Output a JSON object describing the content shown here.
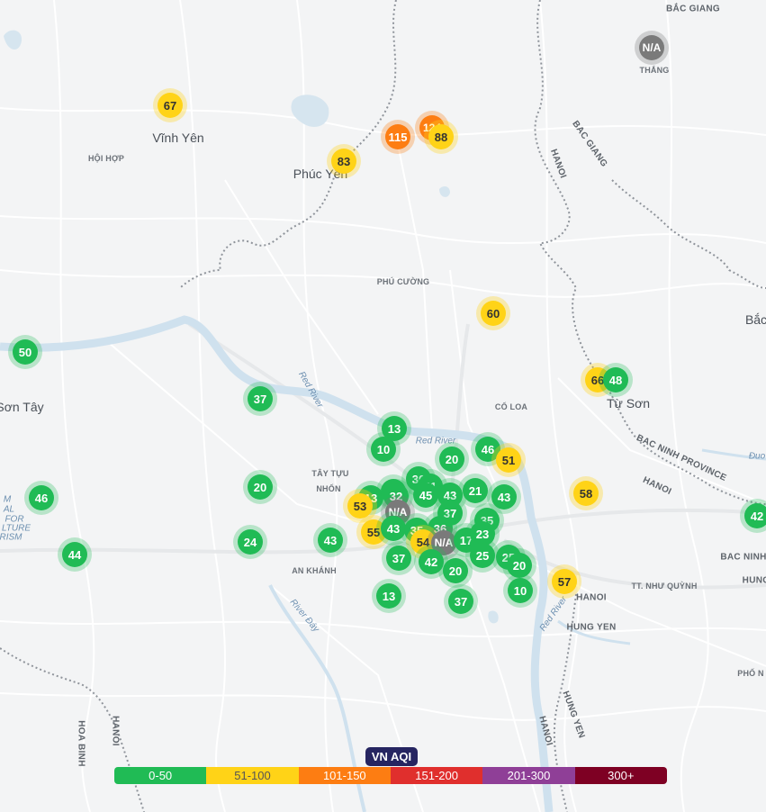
{
  "place_labels": {
    "vinh_yen": "Vĩnh Yên",
    "hoi_hop": "HỘI HỢP",
    "phuc_yen": "Phúc Yên",
    "phu_cuong": "PHÚ CƯỜNG",
    "son_tay": "Sơn Tây",
    "co_loa": "CỔ LOA",
    "tu_son": "Từ Sơn",
    "tay_tuu": "TÂY TỰU",
    "nhon": "NHỔN",
    "an_khanh": "AN KHÁNH",
    "thang": "THẮNG",
    "bac_giang_top": "BẮC GIANG",
    "bac_giang": "BAC GIANG",
    "hanoi_1": "HANOI",
    "bac_ninh_province": "BAC NINH PROVINCE",
    "hanoi_2": "HANOI",
    "hanoi_3": "HANOI",
    "hung_yen": "HUNG YEN",
    "te_nhu_quynh": "TT. NHƯ QUỲNH",
    "bac_ninh": "BAC NINH",
    "hung": "HUNG",
    "pho_n": "PHỐ N",
    "hoa_binh": "HOA BINH",
    "hanoi_4": "HANOI",
    "hanoi_5": "HANOI",
    "hung_yen_2": "HUNG YEN",
    "bac_edge": "Bắc",
    "red_river_1": "Red River",
    "red_river_2": "Red River",
    "red_river_3": "Red River",
    "river_day": "River Đáy",
    "duo_edge": "Đuo",
    "museum_1": "M",
    "museum_2": "AL",
    "museum_3": "FOR",
    "museum_4": "LTURE",
    "museum_5": "RISM"
  },
  "markers": [
    {
      "id": "m1",
      "value": "N/A",
      "level": "na"
    },
    {
      "id": "m2",
      "value": "67",
      "level": "moderate"
    },
    {
      "id": "m3",
      "value": "124",
      "level": "usg"
    },
    {
      "id": "m4",
      "value": "115",
      "level": "usg"
    },
    {
      "id": "m5",
      "value": "88",
      "level": "moderate"
    },
    {
      "id": "m6",
      "value": "83",
      "level": "moderate"
    },
    {
      "id": "m7",
      "value": "60",
      "level": "moderate"
    },
    {
      "id": "m8",
      "value": "50",
      "level": "good"
    },
    {
      "id": "m9",
      "value": "37",
      "level": "good"
    },
    {
      "id": "m10",
      "value": "66",
      "level": "moderate"
    },
    {
      "id": "m11",
      "value": "48",
      "level": "good"
    },
    {
      "id": "m12",
      "value": "13",
      "level": "good"
    },
    {
      "id": "m13",
      "value": "10",
      "level": "good"
    },
    {
      "id": "m14",
      "value": "46",
      "level": "good"
    },
    {
      "id": "m15",
      "value": "20",
      "level": "good"
    },
    {
      "id": "m16",
      "value": "51",
      "level": "moderate"
    },
    {
      "id": "m17",
      "value": "46",
      "level": "good"
    },
    {
      "id": "m18",
      "value": "20",
      "level": "good"
    },
    {
      "id": "m19",
      "value": "58",
      "level": "moderate"
    },
    {
      "id": "m20",
      "value": "42",
      "level": "good"
    },
    {
      "id": "m21",
      "value": "44",
      "level": "good"
    },
    {
      "id": "m22",
      "value": "24",
      "level": "good"
    },
    {
      "id": "m23",
      "value": "43",
      "level": "good"
    },
    {
      "id": "m24",
      "value": "53",
      "level": "moderate"
    },
    {
      "id": "m25",
      "value": "N/A",
      "level": "na"
    },
    {
      "id": "m26",
      "value": "32",
      "level": "good"
    },
    {
      "id": "m27",
      "value": "30",
      "level": "good"
    },
    {
      "id": "m28",
      "value": "45",
      "level": "good"
    },
    {
      "id": "m29",
      "value": "55",
      "level": "moderate"
    },
    {
      "id": "m30",
      "value": "43",
      "level": "good"
    },
    {
      "id": "m31",
      "value": "35",
      "level": "good"
    },
    {
      "id": "m32",
      "value": "36",
      "level": "good"
    },
    {
      "id": "m33",
      "value": "54",
      "level": "moderate"
    },
    {
      "id": "m34",
      "value": "N/A",
      "level": "na"
    },
    {
      "id": "m35",
      "value": "17",
      "level": "good"
    },
    {
      "id": "m36",
      "value": "23",
      "level": "good"
    },
    {
      "id": "m37",
      "value": "35",
      "level": "good"
    },
    {
      "id": "m38",
      "value": "43",
      "level": "good"
    },
    {
      "id": "m39",
      "value": "37",
      "level": "good"
    },
    {
      "id": "m40",
      "value": "42",
      "level": "good"
    },
    {
      "id": "m41",
      "value": "20",
      "level": "good"
    },
    {
      "id": "m42",
      "value": "25",
      "level": "good"
    },
    {
      "id": "m43",
      "value": "25",
      "level": "good"
    },
    {
      "id": "m44",
      "value": "20",
      "level": "good"
    },
    {
      "id": "m45",
      "value": "57",
      "level": "moderate"
    },
    {
      "id": "m46",
      "value": "10",
      "level": "good"
    },
    {
      "id": "m47",
      "value": "13",
      "level": "good"
    },
    {
      "id": "m48",
      "value": "37",
      "level": "good"
    },
    {
      "id": "m49",
      "value": "41",
      "level": "good"
    },
    {
      "id": "m50",
      "value": "13",
      "level": "good"
    },
    {
      "id": "m51",
      "value": "21",
      "level": "good"
    },
    {
      "id": "m52",
      "value": "24",
      "level": "good"
    }
  ],
  "legend": {
    "title": "VN AQI",
    "segments": [
      {
        "label": "0-50",
        "color": "#20bb55",
        "text": "#ffffff"
      },
      {
        "label": "51-100",
        "color": "#ffd317",
        "text": "#555555"
      },
      {
        "label": "101-150",
        "color": "#fd7d12",
        "text": "#ffffff"
      },
      {
        "label": "151-200",
        "color": "#e02f2d",
        "text": "#ffffff"
      },
      {
        "label": "201-300",
        "color": "#8f3f97",
        "text": "#ffffff"
      },
      {
        "label": "300+",
        "color": "#7e0023",
        "text": "#ffffff"
      }
    ]
  }
}
